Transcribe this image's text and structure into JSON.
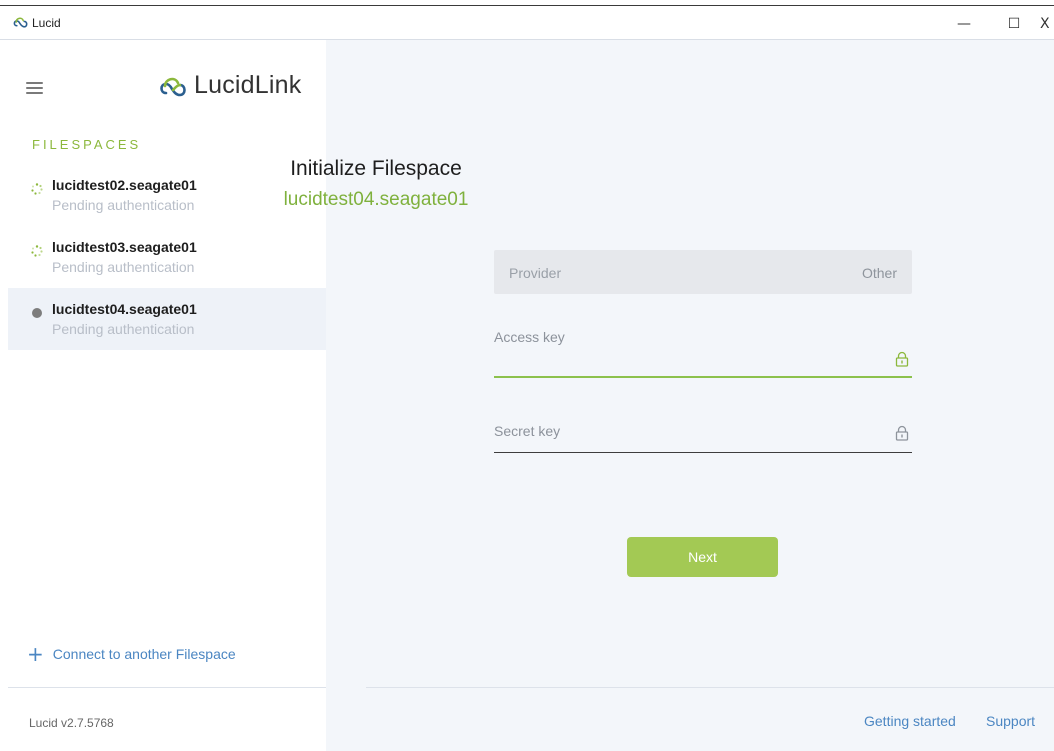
{
  "window": {
    "title": "Lucid",
    "controls": {
      "minimize": "—",
      "maximize": "☐",
      "close": "X"
    }
  },
  "sidebar": {
    "logo_text": "LucidLink",
    "heading": "FILESPACES",
    "items": [
      {
        "name": "lucidtest02.seagate01",
        "status": "Pending authentication",
        "icon": "spinner-icon"
      },
      {
        "name": "lucidtest03.seagate01",
        "status": "Pending authentication",
        "icon": "spinner-icon"
      },
      {
        "name": "lucidtest04.seagate01",
        "status": "Pending authentication",
        "icon": "status-dot-icon"
      }
    ],
    "connect_label": "Connect to another Filespace",
    "version": "Lucid v2.7.5768"
  },
  "main": {
    "title": "Initialize Filespace",
    "subtitle": "lucidtest04.seagate01",
    "provider": {
      "label": "Provider",
      "value": "Other"
    },
    "access_key": {
      "label": "Access key",
      "value": ""
    },
    "secret_key": {
      "label": "Secret key",
      "value": ""
    },
    "next_label": "Next"
  },
  "footer": {
    "getting_started": "Getting started",
    "support": "Support"
  },
  "colors": {
    "accent_green": "#8cb83c",
    "button_green": "#a3c954",
    "link_blue": "#4b86c2",
    "main_bg": "#f3f6fa"
  }
}
